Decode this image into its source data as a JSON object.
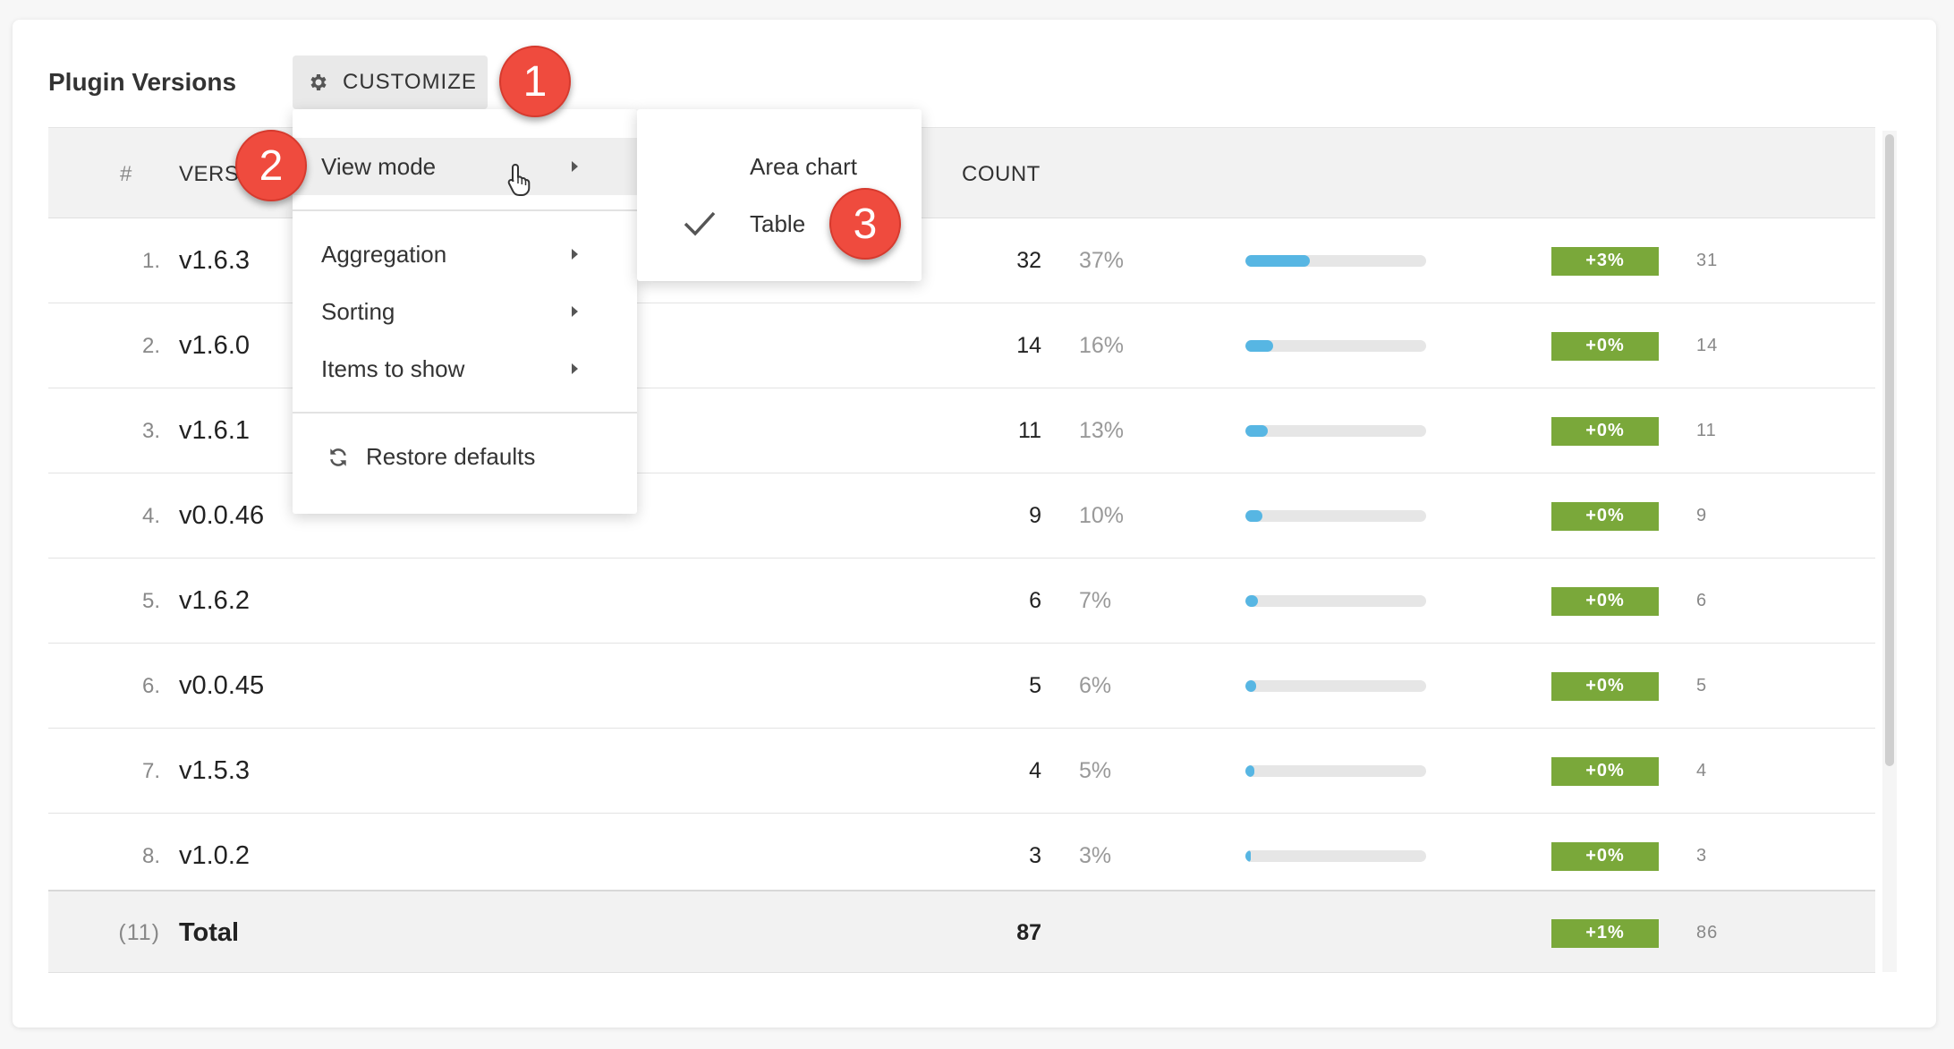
{
  "widget": {
    "title": "Plugin Versions",
    "customize_label": "CUSTOMIZE"
  },
  "table": {
    "headers": {
      "index": "#",
      "version": "VERSION",
      "count": "COUNT"
    },
    "rows": [
      {
        "index": "1.",
        "version": "v1.6.3",
        "count": "32",
        "percent": "37%",
        "share": 0.37,
        "change": "+3%",
        "previous": "31"
      },
      {
        "index": "2.",
        "version": "v1.6.0",
        "count": "14",
        "percent": "16%",
        "share": 0.16,
        "change": "+0%",
        "previous": "14"
      },
      {
        "index": "3.",
        "version": "v1.6.1",
        "count": "11",
        "percent": "13%",
        "share": 0.13,
        "change": "+0%",
        "previous": "11"
      },
      {
        "index": "4.",
        "version": "v0.0.46",
        "count": "9",
        "percent": "10%",
        "share": 0.1,
        "change": "+0%",
        "previous": "9"
      },
      {
        "index": "5.",
        "version": "v1.6.2",
        "count": "6",
        "percent": "7%",
        "share": 0.07,
        "change": "+0%",
        "previous": "6"
      },
      {
        "index": "6.",
        "version": "v0.0.45",
        "count": "5",
        "percent": "6%",
        "share": 0.06,
        "change": "+0%",
        "previous": "5"
      },
      {
        "index": "7.",
        "version": "v1.5.3",
        "count": "4",
        "percent": "5%",
        "share": 0.05,
        "change": "+0%",
        "previous": "4"
      },
      {
        "index": "8.",
        "version": "v1.0.2",
        "count": "3",
        "percent": "3%",
        "share": 0.03,
        "change": "+0%",
        "previous": "3"
      }
    ],
    "total": {
      "index": "(11)",
      "label": "Total",
      "count": "87",
      "change": "+1%",
      "previous": "86"
    }
  },
  "menu": {
    "view_mode": "View mode",
    "aggregation": "Aggregation",
    "sorting": "Sorting",
    "items_to_show": "Items to show",
    "restore_defaults": "Restore defaults"
  },
  "submenu": {
    "area_chart": "Area chart",
    "table": "Table",
    "selected": "Table"
  },
  "callouts": [
    "1",
    "2",
    "3"
  ],
  "colors": {
    "bar_fill": "#57b6e3",
    "badge": "#7aa83a",
    "callout": "#ef4b3e"
  }
}
